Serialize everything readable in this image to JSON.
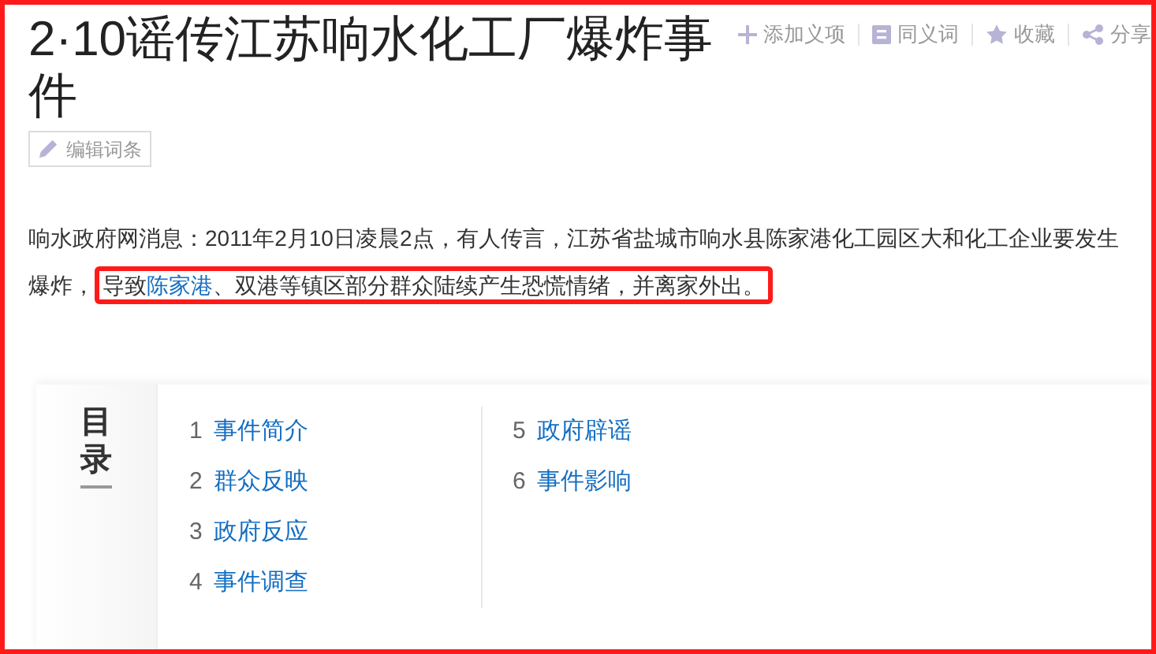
{
  "title": "2·10谣传江苏响水化工厂爆炸事件",
  "actions": [
    {
      "kind": "add",
      "label": "添加义项"
    },
    {
      "kind": "synonym",
      "label": "同义词"
    },
    {
      "kind": "favorite",
      "label": "收藏"
    },
    {
      "kind": "share",
      "label": "分享"
    }
  ],
  "edit_button": "编辑词条",
  "intro": {
    "text_before": "响水政府网消息：2011年2月10日凌晨2点，有人传言，江苏省盐城市响水县陈家港化工园区大和化工企业要发生爆炸，",
    "highlight": {
      "before": "导致",
      "link": "陈家港",
      "after": "、双港等镇区部分群众陆续产生恐慌情绪，并离家外出。"
    }
  },
  "toc": {
    "title": "目录",
    "columns": [
      [
        {
          "number": "1",
          "label": "事件简介"
        },
        {
          "number": "2",
          "label": "群众反映"
        },
        {
          "number": "3",
          "label": "政府反应"
        },
        {
          "number": "4",
          "label": "事件调查"
        }
      ],
      [
        {
          "number": "5",
          "label": "政府辟谣"
        },
        {
          "number": "6",
          "label": "事件影响"
        }
      ]
    ]
  }
}
